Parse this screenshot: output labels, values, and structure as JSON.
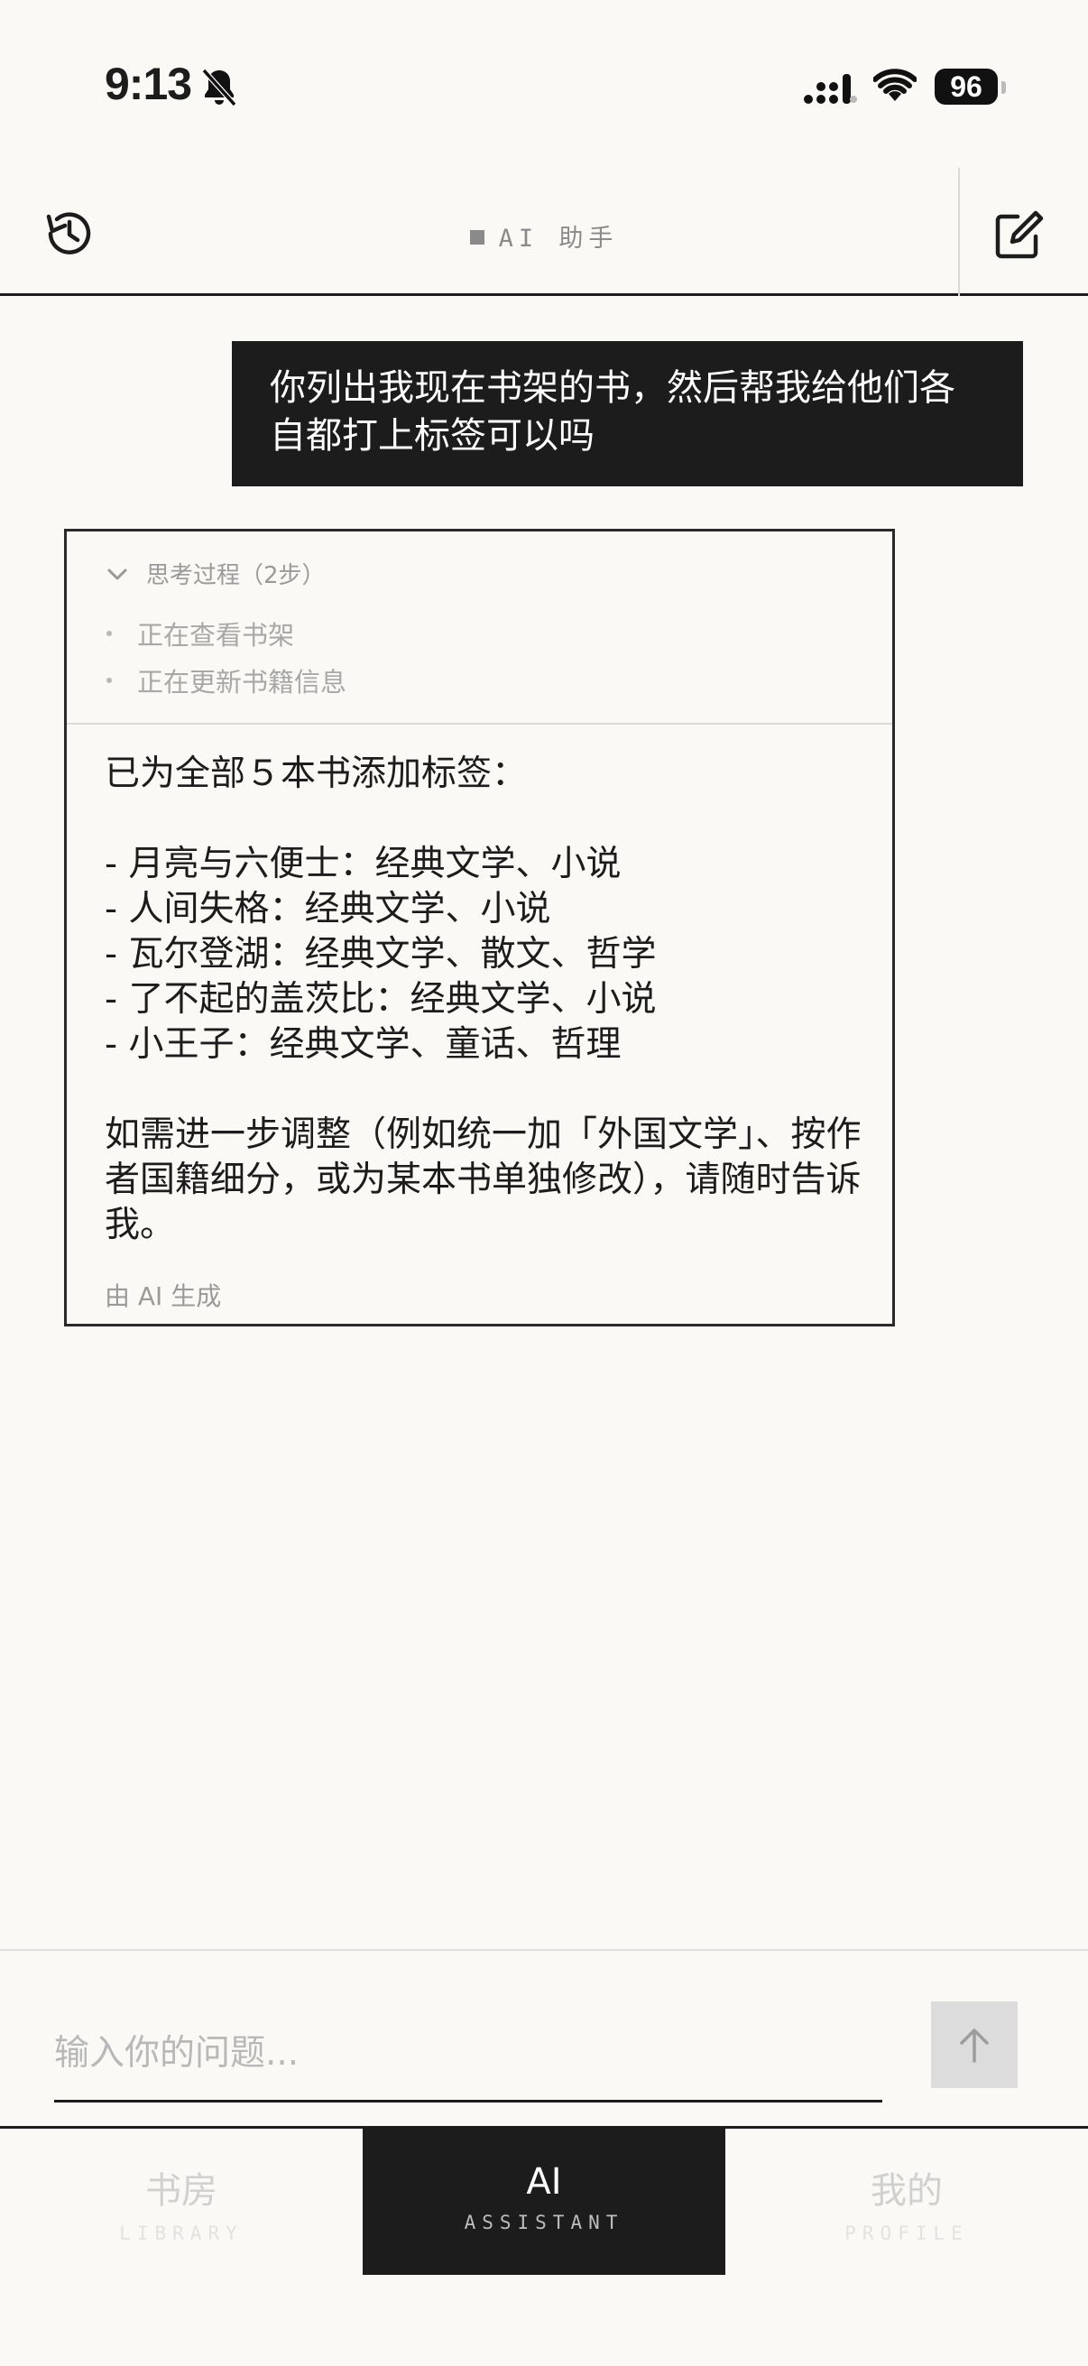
{
  "status_bar": {
    "time": "9:13",
    "battery": "96"
  },
  "header": {
    "title": "AI 助手",
    "history_icon": "history-icon",
    "new_chat_icon": "compose-icon"
  },
  "conversation": {
    "user_message": "你列出我现在书架的书，然后帮我给他们各自都打上标签可以吗",
    "thinking": {
      "label": "思考过程（2步）",
      "steps": [
        "正在查看书架",
        "正在更新书籍信息"
      ]
    },
    "answer": "已为全部５本书添加标签：\n\n- 月亮与六便士：经典文学、小说\n- 人间失格：经典文学、小说\n- 瓦尔登湖：经典文学、散文、哲学\n- 了不起的盖茨比：经典文学、小说\n- 小王子：经典文学、童话、哲理\n\n如需进一步调整（例如统一加「外国文学」、按作者国籍细分，或为某本书单独修改），请随时告诉我。",
    "footer": "由 AI 生成"
  },
  "input": {
    "placeholder": "输入你的问题...",
    "value": ""
  },
  "tabs": [
    {
      "label": "书房",
      "sub": "LIBRARY",
      "active": false
    },
    {
      "label": "AI",
      "sub": "ASSISTANT",
      "active": true
    },
    {
      "label": "我的",
      "sub": "PROFILE",
      "active": false
    }
  ],
  "colors": {
    "background": "#faf9f6",
    "ink": "#1c1c1c",
    "muted": "#9a9a9a"
  }
}
